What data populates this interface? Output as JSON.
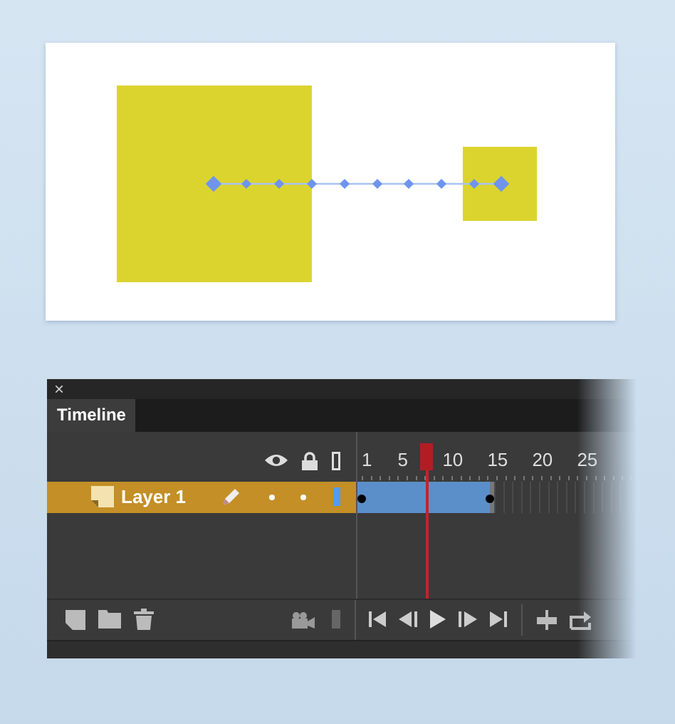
{
  "stage": {
    "kind": "motion-tween"
  },
  "timeline": {
    "close": "×",
    "tabs": [
      {
        "label": "Timeline",
        "selected": true
      }
    ],
    "frame_numbers": [
      "1",
      "5",
      "10",
      "15",
      "20",
      "25"
    ],
    "layers": [
      {
        "name": "Layer 1",
        "selected": true
      }
    ]
  }
}
